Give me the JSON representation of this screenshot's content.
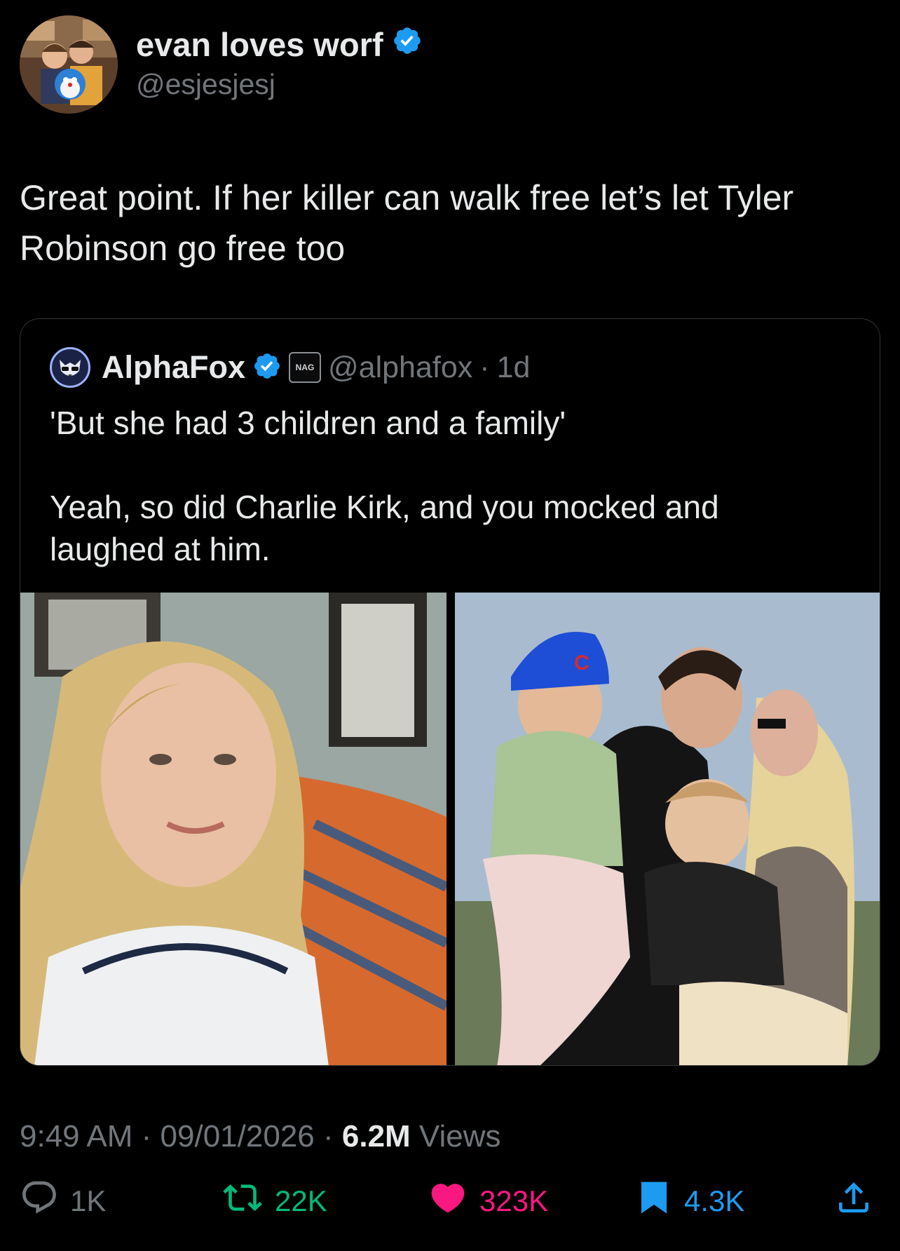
{
  "author": {
    "display_name": "evan loves worf",
    "handle": "@esjesjesj",
    "verified": true
  },
  "tweet": {
    "text": "Great point. If her killer can walk free let’s let Tyler\nRobinson go free too"
  },
  "quote": {
    "display_name": "AlphaFox",
    "badge_text": "NAG",
    "handle": "@alphafox",
    "separator": "·",
    "time": "1d",
    "text": "'But she had 3 children and a family'\n\nYeah, so did Charlie Kirk, and you mocked and\nlaughed at him.",
    "images": [
      {
        "name": "photo-woman-portrait"
      },
      {
        "name": "photo-family-with-children"
      }
    ],
    "cap_letter": "C"
  },
  "meta": {
    "time": "9:49 AM",
    "sep1": " · ",
    "date": "09/01/2026",
    "sep2": " · ",
    "views_count": "6.2M",
    "views_label": " Views"
  },
  "actions": {
    "reply_count": "1K",
    "retweet_count": "22K",
    "like_count": "323K",
    "bookmark_count": "4.3K"
  },
  "colors": {
    "background": "#000000",
    "text": "#e7e9ea",
    "muted": "#71767b",
    "verified": "#1d9bf0",
    "retweet": "#00ba7c",
    "like": "#f91880",
    "bookmark": "#1d9bf0"
  },
  "icons": [
    "verified-icon",
    "reply-icon",
    "retweet-icon",
    "like-icon",
    "bookmark-icon",
    "share-icon"
  ]
}
